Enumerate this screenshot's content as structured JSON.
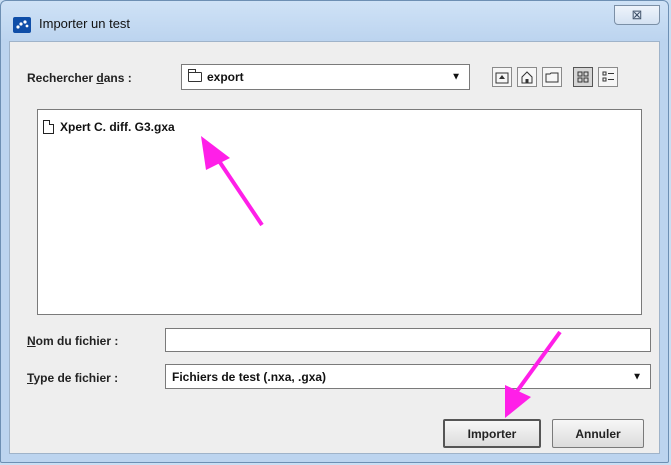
{
  "window": {
    "title": "Importer un test",
    "close_glyph": "⊠"
  },
  "look_in": {
    "label_prefix": "Rechercher ",
    "label_mnemonic": "d",
    "label_suffix": "ans :",
    "value": "export"
  },
  "toolbar": {
    "icons": [
      "up-folder-icon",
      "home-icon",
      "new-folder-icon",
      "list-view-icon",
      "details-view-icon"
    ]
  },
  "files": [
    {
      "name": "Xpert C. diff. G3.gxa",
      "icon": "document-icon"
    }
  ],
  "file_name": {
    "label_mnemonic": "N",
    "label_rest": "om du fichier :",
    "value": ""
  },
  "file_type": {
    "label_mnemonic": "T",
    "label_rest": "ype de fichier :",
    "value": "Fichiers de test (.nxa, .gxa)"
  },
  "buttons": {
    "import": "Importer",
    "cancel": "Annuler"
  },
  "colors": {
    "annotation": "#ff1fe8",
    "title_bg": "#c9def3"
  }
}
